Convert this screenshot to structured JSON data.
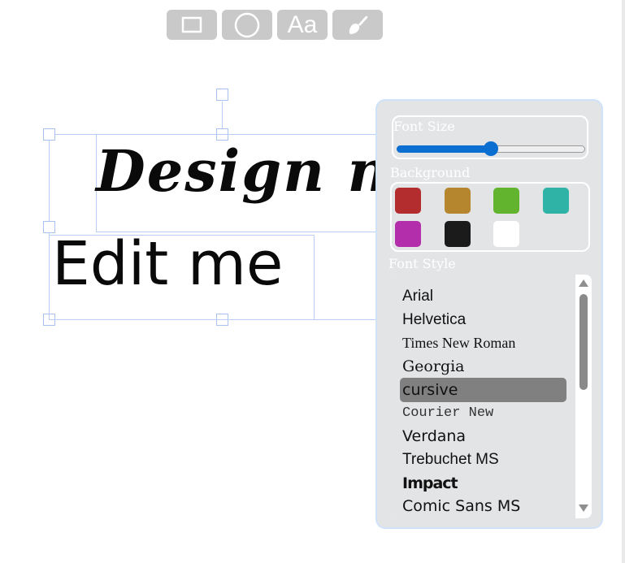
{
  "toolbar": {
    "buttons": [
      {
        "name": "rectangle-tool",
        "icon": "rectangle-icon"
      },
      {
        "name": "circle-tool",
        "icon": "circle-icon"
      },
      {
        "name": "text-tool",
        "icon": "text-icon",
        "label": "Aa"
      },
      {
        "name": "paint-tool",
        "icon": "paint-brush-icon"
      }
    ]
  },
  "canvas": {
    "text_1": "Design noo",
    "text_2": "Edit me"
  },
  "panel": {
    "font_size_label": "Font Size",
    "font_size_value": 0.5,
    "background_label": "Background",
    "background_colors": [
      "#b32d2e",
      "#b5862e",
      "#62b32e",
      "#2eb3a6",
      "#b32eaa",
      "#1b1b1b",
      "#ffffff"
    ],
    "font_style_label": "Font Style",
    "fonts": [
      "Arial",
      "Helvetica",
      "Times New Roman",
      "Georgia",
      "cursive",
      "Courier New",
      "Verdana",
      "Trebuchet MS",
      "Impact",
      "Comic Sans MS"
    ],
    "selected_font": "cursive"
  },
  "colors": {
    "accent": "#0a6fd1",
    "toolbar_button": "#c9c9c9",
    "panel_background": "#e3e4e6",
    "selection": "#b9cef4"
  }
}
